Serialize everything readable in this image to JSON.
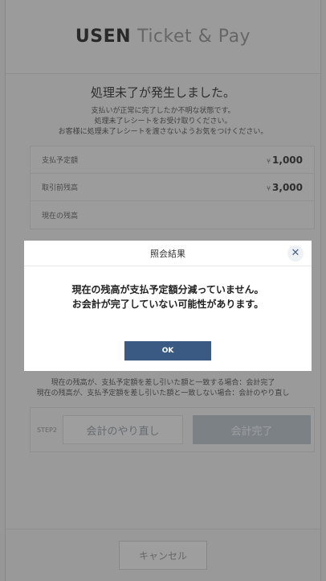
{
  "header": {
    "brand_strong": "USEN",
    "brand_light": "Ticket & Pay"
  },
  "error": {
    "title": "処理未了が発生しました。",
    "lines": [
      "支払いが正常に完了したか不明な状態です。",
      "処理未了レシートをお受け取りください。",
      "お客様に処理未了レシートを渡さないようお気をつけください。"
    ]
  },
  "info": {
    "rows": [
      {
        "label": "支払予定額",
        "currency": "¥",
        "value": "1,000"
      },
      {
        "label": "取引前残高",
        "currency": "¥",
        "value": "3,000"
      },
      {
        "label": "現在の残高",
        "currency": "",
        "value": ""
      }
    ]
  },
  "notes": [
    "現在の残高が、支払予定額を差し引いた額と一致する場合：会計完了",
    "現在の残高が、支払予定額を差し引いた額と一致しない場合：会計のやり直し"
  ],
  "step": {
    "label": "STEP2",
    "redo_label": "会計のやり直し",
    "complete_label": "会計完了"
  },
  "footer": {
    "cancel_label": "キャンセル"
  },
  "modal": {
    "title": "照会結果",
    "close_glyph": "✕",
    "message_lines": [
      "現在の残高が支払予定額分減っていません。",
      "お会計が完了していない可能性があります。"
    ],
    "ok_label": "OK"
  },
  "colors": {
    "ok_button": "#3a5a83",
    "complete_button": "#c1cad4",
    "overlay": "rgba(40,40,40,0.45)"
  }
}
